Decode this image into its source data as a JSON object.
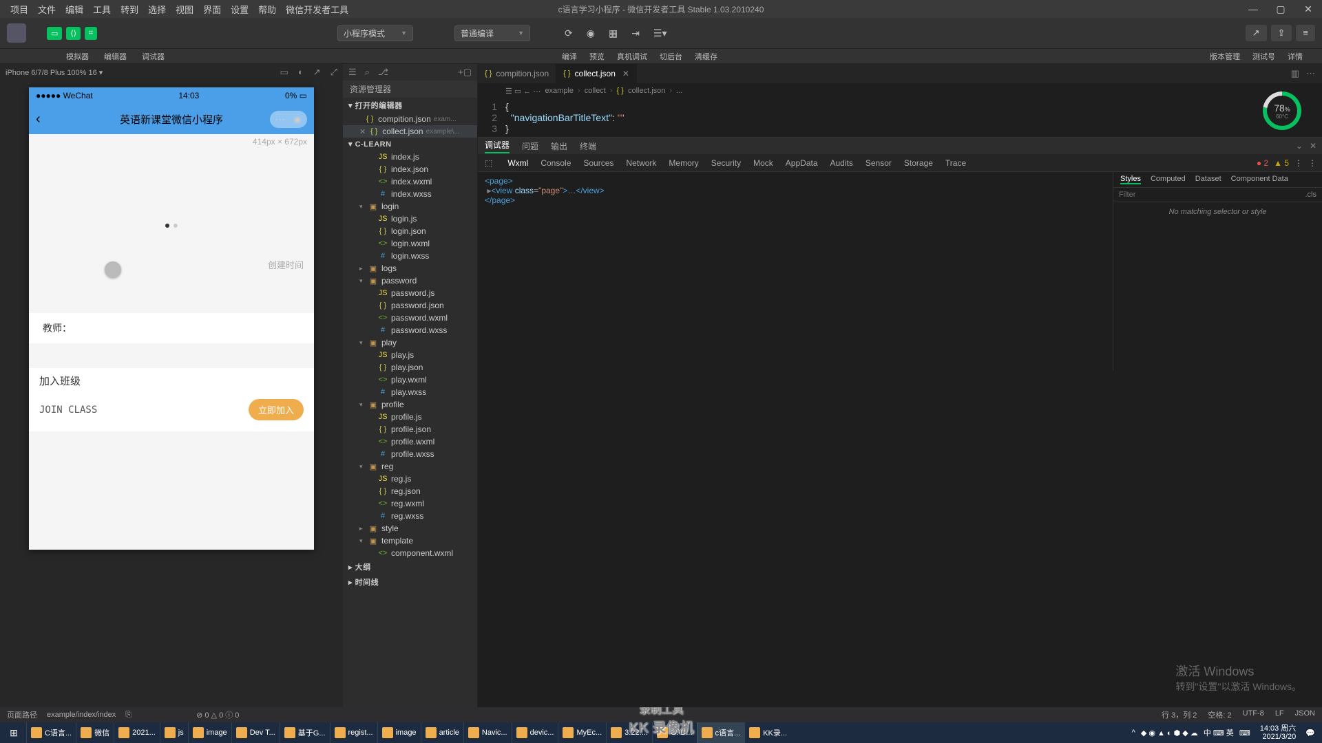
{
  "titlebar": {
    "menus": [
      "项目",
      "文件",
      "编辑",
      "工具",
      "转到",
      "选择",
      "视图",
      "界面",
      "设置",
      "帮助",
      "微信开发者工具"
    ],
    "center": "c语言学习小程序 - 微信开发者工具 Stable 1.03.2010240"
  },
  "toolbar": {
    "sim_label": "模拟器",
    "edit_label": "编辑器",
    "debug_label": "调试器",
    "mode_select": "小程序模式",
    "compile_select": "普通编译",
    "mid_labels": [
      "编译",
      "预览",
      "真机调试",
      "切后台",
      "清缓存"
    ],
    "right_labels": [
      "版本管理",
      "测试号",
      "详情"
    ]
  },
  "sim": {
    "device_info": "iPhone 6/7/8 Plus 100% 16 ▾",
    "page_path": "页面路径",
    "page_path_value": "example/index/index"
  },
  "phone": {
    "status_left": "●●●●● WeChat",
    "status_time": "14:03",
    "status_right": "0%",
    "nav_title": "英语新课堂微信小程序",
    "dim": "414px × 672px",
    "create_time": "创建时间",
    "teacher": "教师：",
    "join_hdr": "加入班级",
    "join_code": "JOIN CLASS",
    "join_btn": "立即加入",
    "watermark1": "录制工具",
    "watermark2": "KK 录像机"
  },
  "sidebar": {
    "hdr": "资源管理器",
    "open_editors": "打开的编辑器",
    "open_files": [
      {
        "name": "compition.json",
        "suffix": "exam..."
      },
      {
        "name": "collect.json",
        "suffix": "example\\..."
      }
    ],
    "project": "C-LEARN",
    "tree": [
      {
        "name": "index.js",
        "ico": "js"
      },
      {
        "name": "index.json",
        "ico": "json"
      },
      {
        "name": "index.wxml",
        "ico": "wxml"
      },
      {
        "name": "index.wxss",
        "ico": "wxss"
      },
      {
        "type": "folder",
        "name": "login",
        "children": [
          {
            "name": "login.js",
            "ico": "js"
          },
          {
            "name": "login.json",
            "ico": "json"
          },
          {
            "name": "login.wxml",
            "ico": "wxml"
          },
          {
            "name": "login.wxss",
            "ico": "wxss"
          }
        ]
      },
      {
        "type": "folder",
        "name": "logs",
        "children": []
      },
      {
        "type": "folder",
        "name": "password",
        "children": [
          {
            "name": "password.js",
            "ico": "js"
          },
          {
            "name": "password.json",
            "ico": "json"
          },
          {
            "name": "password.wxml",
            "ico": "wxml"
          },
          {
            "name": "password.wxss",
            "ico": "wxss"
          }
        ]
      },
      {
        "type": "folder",
        "name": "play",
        "children": [
          {
            "name": "play.js",
            "ico": "js"
          },
          {
            "name": "play.json",
            "ico": "json"
          },
          {
            "name": "play.wxml",
            "ico": "wxml"
          },
          {
            "name": "play.wxss",
            "ico": "wxss"
          }
        ]
      },
      {
        "type": "folder",
        "name": "profile",
        "children": [
          {
            "name": "profile.js",
            "ico": "js"
          },
          {
            "name": "profile.json",
            "ico": "json"
          },
          {
            "name": "profile.wxml",
            "ico": "wxml"
          },
          {
            "name": "profile.wxss",
            "ico": "wxss"
          }
        ]
      },
      {
        "type": "folder",
        "name": "reg",
        "children": [
          {
            "name": "reg.js",
            "ico": "js"
          },
          {
            "name": "reg.json",
            "ico": "json"
          },
          {
            "name": "reg.wxml",
            "ico": "wxml"
          },
          {
            "name": "reg.wxss",
            "ico": "wxss"
          }
        ]
      },
      {
        "type": "folder",
        "name": "style",
        "children": []
      },
      {
        "type": "folder",
        "name": "template",
        "children": [
          {
            "name": "component.wxml",
            "ico": "wxml"
          }
        ]
      }
    ],
    "bottom": [
      "大纲",
      "时间线"
    ]
  },
  "editor": {
    "tabs": [
      {
        "name": "compition.json"
      },
      {
        "name": "collect.json",
        "active": true
      }
    ],
    "breadcrumb": [
      "example",
      "collect",
      "collect.json",
      "..."
    ],
    "code_key": "navigationBarTitleText",
    "gauge_pct": "78",
    "gauge_unit": "%",
    "gauge_ms": "60°C"
  },
  "devtools": {
    "tabs1": [
      "调试器",
      "问题",
      "输出",
      "终端"
    ],
    "tabs2": [
      "Wxml",
      "Console",
      "Sources",
      "Network",
      "Memory",
      "Security",
      "Mock",
      "AppData",
      "Audits",
      "Sensor",
      "Storage",
      "Trace"
    ],
    "err_count": "2",
    "warn_count": "5",
    "wxml_lines": [
      "<page>",
      "  ▸<view class=\"page\">…</view>",
      "</page>"
    ],
    "styles_tabs": [
      "Styles",
      "Computed",
      "Dataset",
      "Component Data"
    ],
    "filter_placeholder": "Filter",
    "cls": ".cls",
    "no_match": "No matching selector or style"
  },
  "activate": {
    "l1": "激活 Windows",
    "l2": "转到\"设置\"以激活 Windows。"
  },
  "statusbar": {
    "left_errs": "⊘ 0 △ 0 ⓘ 0",
    "right": [
      "行 3，列 2",
      "空格: 2",
      "UTF-8",
      "LF",
      "JSON"
    ]
  },
  "taskbar": {
    "items": [
      "C语言...",
      "微信",
      "2021...",
      "js",
      "image",
      "Dev T...",
      "基于G...",
      "regist...",
      "image",
      "article",
      "Navic...",
      "devic...",
      "MyEc...",
      "3.22....",
      "G:\\D...",
      "c语言...",
      "KK录..."
    ],
    "tray_ime": "中 ⌨ 英",
    "time": "14:03",
    "date": "2021/3/20",
    "day": "周六"
  }
}
